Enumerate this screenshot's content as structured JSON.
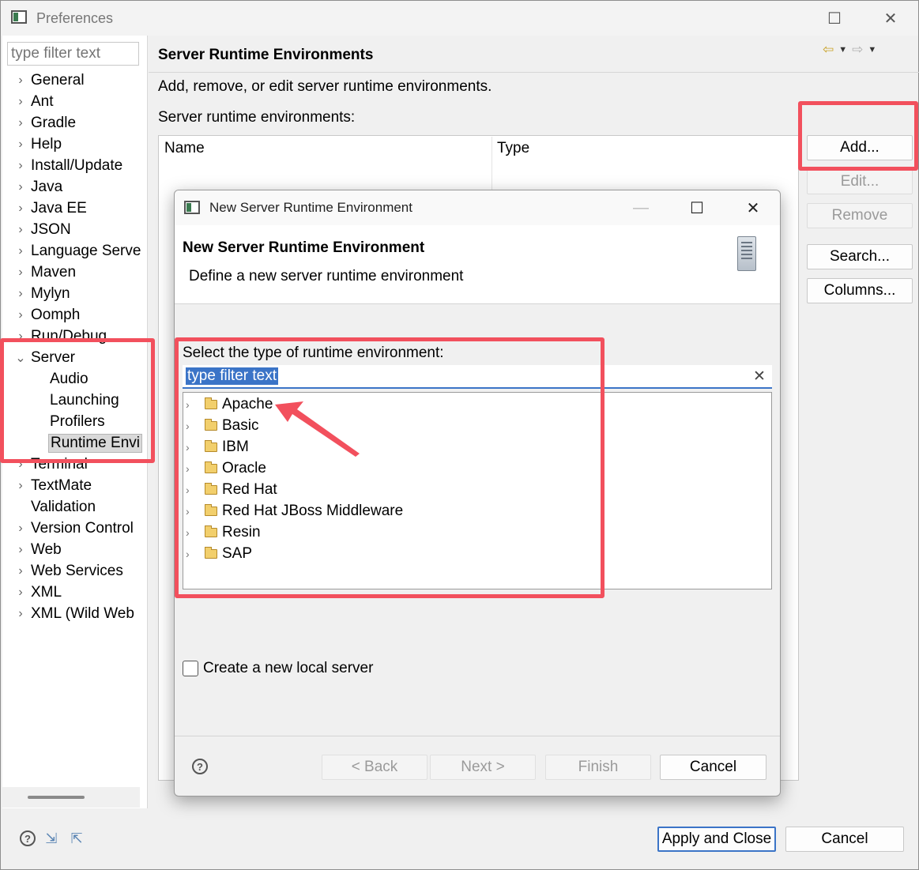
{
  "prefs": {
    "title": "Preferences",
    "filter_placeholder": "type filter text",
    "tree": [
      {
        "label": "General",
        "expand": "›"
      },
      {
        "label": "Ant",
        "expand": "›"
      },
      {
        "label": "Gradle",
        "expand": "›"
      },
      {
        "label": "Help",
        "expand": "›"
      },
      {
        "label": "Install/Update",
        "expand": "›"
      },
      {
        "label": "Java",
        "expand": "›"
      },
      {
        "label": "Java EE",
        "expand": "›"
      },
      {
        "label": "JSON",
        "expand": "›"
      },
      {
        "label": "Language Serve",
        "expand": "›"
      },
      {
        "label": "Maven",
        "expand": "›"
      },
      {
        "label": "Mylyn",
        "expand": "›"
      },
      {
        "label": "Oomph",
        "expand": "›"
      },
      {
        "label": "Run/Debug",
        "expand": "›"
      },
      {
        "label": "Server",
        "expand": "⌄"
      },
      {
        "label": "Audio"
      },
      {
        "label": "Launching"
      },
      {
        "label": "Profilers"
      },
      {
        "label": "Runtime Envi"
      },
      {
        "label": "Terminal",
        "expand": "›"
      },
      {
        "label": "TextMate",
        "expand": "›"
      },
      {
        "label": "Validation"
      },
      {
        "label": "Version Control",
        "expand": "›"
      },
      {
        "label": "Web",
        "expand": "›"
      },
      {
        "label": "Web Services",
        "expand": "›"
      },
      {
        "label": "XML",
        "expand": "›"
      },
      {
        "label": "XML (Wild Web",
        "expand": "›"
      }
    ],
    "page_title": "Server Runtime Environments",
    "page_description": "Add, remove, or edit server runtime environments.",
    "table_label": "Server runtime environments:",
    "columns": [
      "Name",
      "Type"
    ],
    "buttons": {
      "add": "Add...",
      "edit": "Edit...",
      "remove": "Remove",
      "search": "Search...",
      "columns": "Columns...",
      "apply_close": "Apply and Close",
      "cancel": "Cancel"
    }
  },
  "dialog": {
    "title": "New Server Runtime Environment",
    "header_title": "New Server Runtime Environment",
    "header_description": "Define a new server runtime environment",
    "select_label": "Select the type of runtime environment:",
    "filter_text": "type filter text",
    "runtime_types": [
      "Apache",
      "Basic",
      "IBM",
      "Oracle",
      "Red Hat",
      "Red Hat JBoss Middleware",
      "Resin",
      "SAP"
    ],
    "checkbox_label": "Create a new local server",
    "checkbox_checked": false,
    "buttons": {
      "back": "< Back",
      "next": "Next >",
      "finish": "Finish",
      "cancel": "Cancel"
    }
  },
  "colors": {
    "highlight": "#f2505d",
    "selection": "#3b74c7"
  }
}
